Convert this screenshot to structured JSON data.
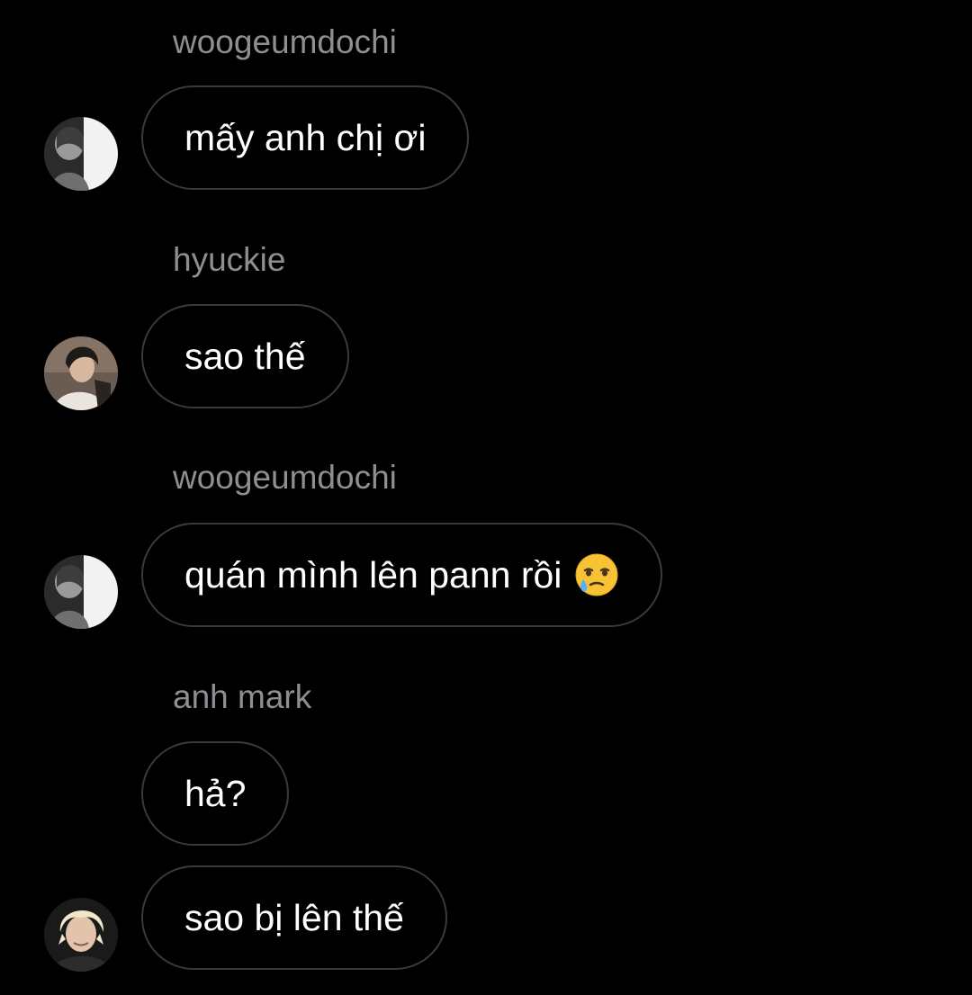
{
  "messages": [
    {
      "sender": "woogeumdochi",
      "texts": [
        "mấy anh chị ơi"
      ],
      "avatar_icon": "grayscale-portrait-avatar-icon"
    },
    {
      "sender": "hyuckie",
      "texts": [
        "sao thế"
      ],
      "avatar_icon": "dark-haired-portrait-avatar-icon"
    },
    {
      "sender": "woogeumdochi",
      "texts": [
        "quán mình lên pann rồi"
      ],
      "emoji": "face-holding-back-tears-icon",
      "avatar_icon": "grayscale-portrait-avatar-icon"
    },
    {
      "sender": "anh mark",
      "texts": [
        "hả?",
        "sao bị lên thế"
      ],
      "avatar_icon": "blonde-portrait-avatar-icon"
    }
  ],
  "colors": {
    "background": "#000000",
    "bubble_border": "#3a3a3c",
    "sender_text": "#8e8e93",
    "message_text": "#ffffff"
  }
}
